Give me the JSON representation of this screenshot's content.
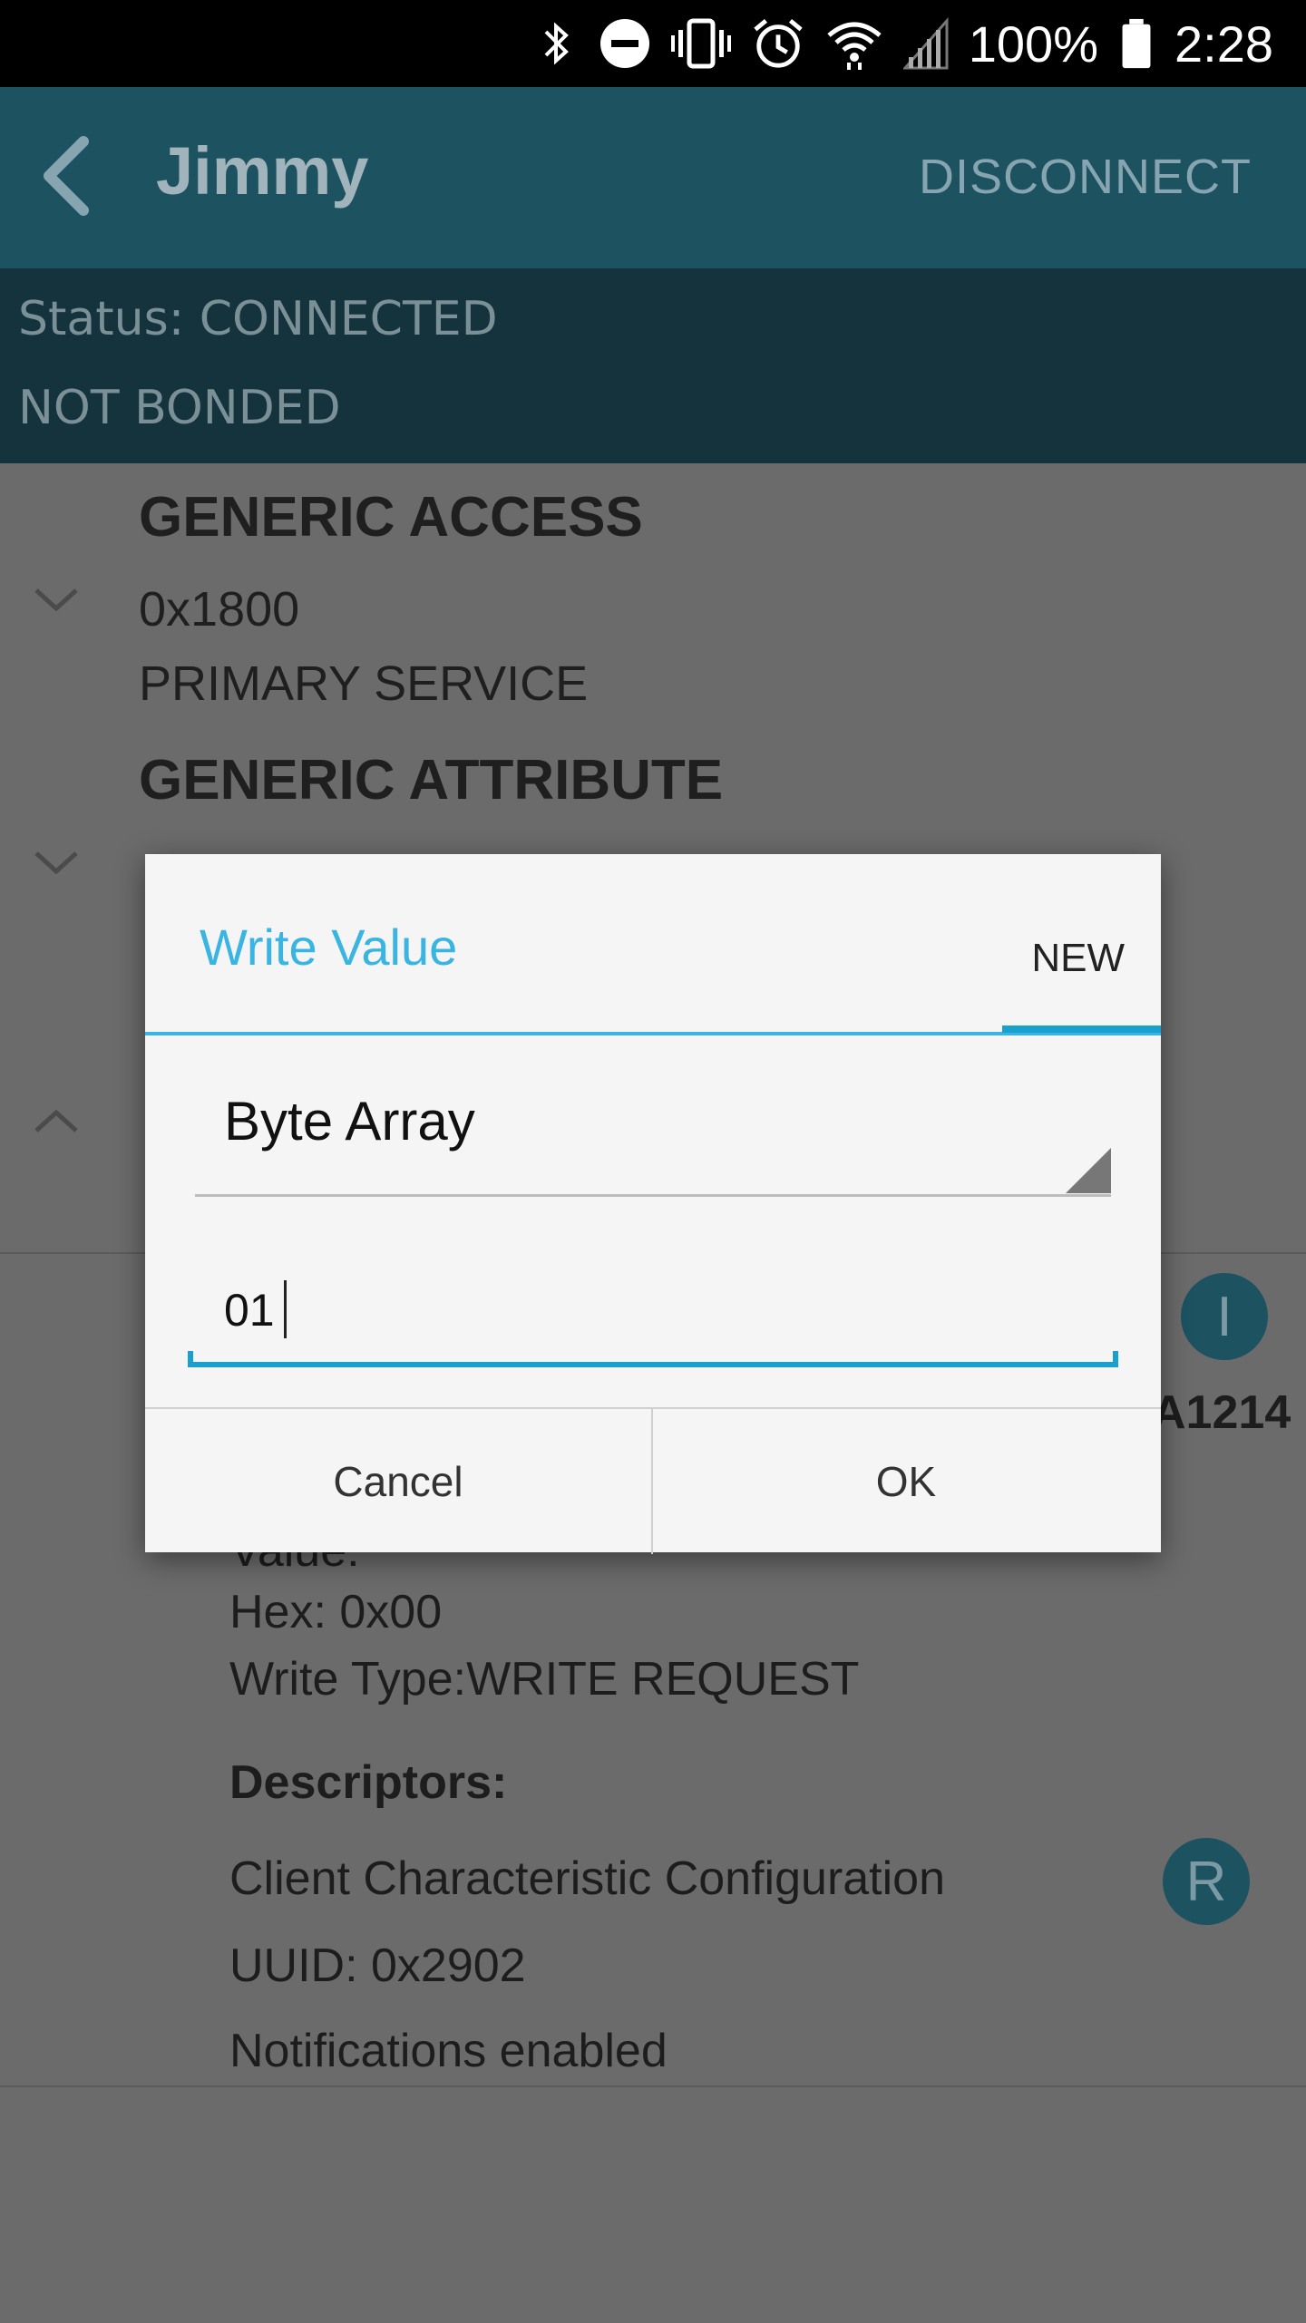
{
  "status_bar": {
    "battery": "100%",
    "time": "2:28",
    "icons": [
      "bluetooth-icon",
      "dnd-icon",
      "vibrate-icon",
      "alarm-icon",
      "wifi-icon",
      "signal-icon",
      "battery-icon"
    ]
  },
  "app_bar": {
    "title": "Jimmy",
    "action": "DISCONNECT"
  },
  "connection": {
    "status": "Status: CONNECTED",
    "bond": "NOT BONDED"
  },
  "services": [
    {
      "title": "GENERIC ACCESS",
      "uuid": "0x1800",
      "type": "PRIMARY SERVICE"
    },
    {
      "title": "GENERIC ATTRIBUTE",
      "uuid": "",
      "type": ""
    }
  ],
  "characteristic": {
    "uuid_suffix": "A1214",
    "value_label": "Value:",
    "hex": "Hex: 0x00",
    "write_type": "Write Type:WRITE REQUEST",
    "descriptors_label": "Descriptors:",
    "descriptor_name": "Client Characteristic Configuration",
    "descriptor_uuid": "UUID: 0x2902",
    "descriptor_status": "Notifications enabled",
    "badge_i": "I",
    "badge_r": "R"
  },
  "dialog": {
    "title": "Write Value",
    "tab": "NEW",
    "format_selected": "Byte Array",
    "input_value": "01",
    "cancel": "Cancel",
    "ok": "OK"
  },
  "colors": {
    "app_bar": "#1d5261",
    "status_panel": "#14333d",
    "accent": "#3ab4e0",
    "scrim": "#6b6b6b"
  }
}
